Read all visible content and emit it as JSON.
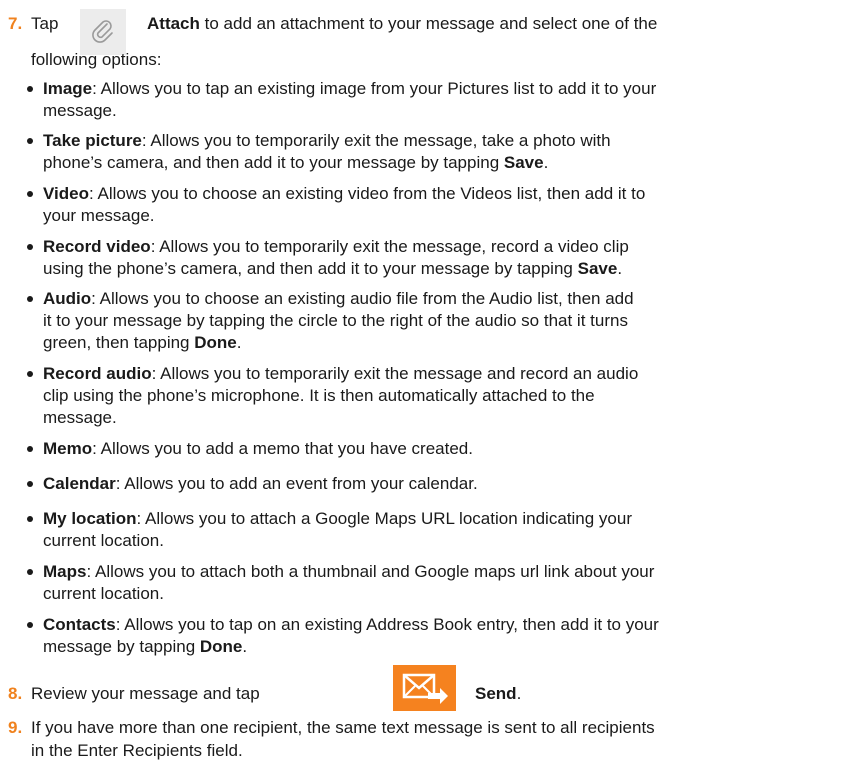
{
  "step7": {
    "number": "7.",
    "tap": "Tap",
    "attach": "Attach",
    "intro_rest": "to add an attachment to your message and select one of the",
    "intro_cont": "following options:"
  },
  "options": [
    {
      "name": "Image",
      "l1": ": Allows you to tap an existing image from your Pictures list to add it to your",
      "l2": "message."
    },
    {
      "name": "Take picture",
      "l1": ": Allows you to temporarily exit the message, take a photo with",
      "l2a": "phone’s camera, and then add it to your message by tapping ",
      "l2b": "Save",
      "l2c": "."
    },
    {
      "name": "Video",
      "l1": ": Allows you to choose an existing video from the Videos list, then add it to",
      "l2": "your message."
    },
    {
      "name": "Record video",
      "l1": ": Allows you to temporarily exit the message, record a video clip",
      "l2a": "using the phone’s camera, and then add it to your message by tapping ",
      "l2b": "Save",
      "l2c": "."
    },
    {
      "name": "Audio",
      "l1": ": Allows you to choose an existing audio file from the Audio list, then add",
      "l2": "it to your message by tapping the circle to the right of the audio so that it turns",
      "l3a": "green, then tapping ",
      "l3b": "Done",
      "l3c": "."
    },
    {
      "name": "Record audio",
      "l1": ": Allows you to temporarily exit the message and record an audio",
      "l2": "clip using the phone’s microphone. It is then automatically attached to the",
      "l3": "message."
    },
    {
      "name": "Memo",
      "l1": ": Allows you to add a memo that you have created."
    },
    {
      "name": "Calendar",
      "l1": ": Allows you to add an event from your calendar."
    },
    {
      "name": "My location",
      "l1": ": Allows you to attach a Google Maps URL location indicating your",
      "l2": "current location."
    },
    {
      "name": "Maps",
      "l1": ": Allows you to attach both a thumbnail and Google maps url link about your",
      "l2": "current location."
    },
    {
      "name": "Contacts",
      "l1": ": Allows you to tap on an existing Address Book entry, then add it to your",
      "l2a": "message by tapping ",
      "l2b": "Done",
      "l2c": "."
    }
  ],
  "step8": {
    "number": "8.",
    "text": "Review your message and tap",
    "send": "Send",
    "end": "."
  },
  "step9": {
    "number": "9.",
    "l1": "If you have more than one recipient, the same text message is sent to all recipients",
    "l2": "in the Enter Recipients field."
  },
  "colors": {
    "step_number": "#f0821e",
    "send_icon_bg": "#f5821f",
    "attach_icon_bg": "#ececec"
  },
  "icons": {
    "attach": "paperclip-icon",
    "send": "send-message-icon"
  }
}
